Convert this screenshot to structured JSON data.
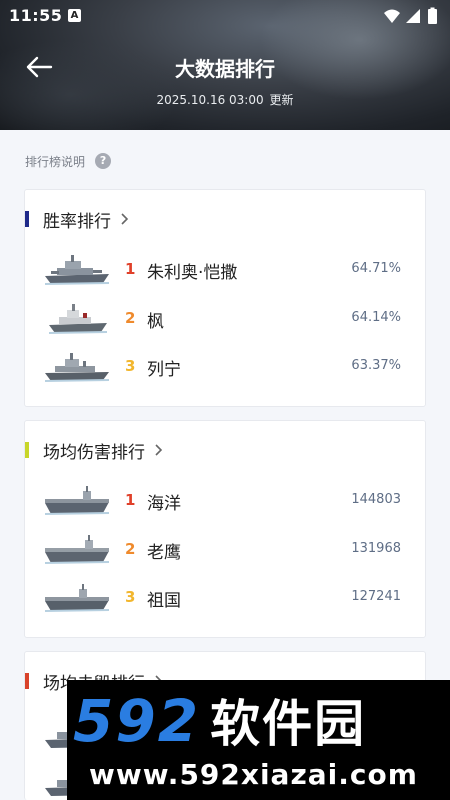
{
  "status_bar": {
    "time": "11:55",
    "badge": "A"
  },
  "header": {
    "title": "大数据排行",
    "update_time": "2025.10.16 03:00",
    "update_label": "更新"
  },
  "help": {
    "label": "排行榜说明",
    "icon": "?"
  },
  "cards": [
    {
      "title": "胜率排行",
      "accent": "#1f2a8a",
      "rows": [
        {
          "rank": "1",
          "name": "朱利奥·恺撒",
          "value": "64.71%"
        },
        {
          "rank": "2",
          "name": "枫",
          "value": "64.14%"
        },
        {
          "rank": "3",
          "name": "列宁",
          "value": "63.37%"
        }
      ]
    },
    {
      "title": "场均伤害排行",
      "accent": "#c8d62a",
      "rows": [
        {
          "rank": "1",
          "name": "海洋",
          "value": "144803"
        },
        {
          "rank": "2",
          "name": "老鹰",
          "value": "131968"
        },
        {
          "rank": "3",
          "name": "祖国",
          "value": "127241"
        }
      ]
    },
    {
      "title": "场均击毁排行",
      "accent": "#d9432b",
      "rows": []
    }
  ],
  "rank_colors": {
    "1": "#e0402a",
    "2": "#ef8a2c",
    "3": "#f2b62d"
  },
  "watermark": {
    "brand_digits": "592",
    "brand_text": "软件园",
    "url": "www.592xiazai.com"
  }
}
